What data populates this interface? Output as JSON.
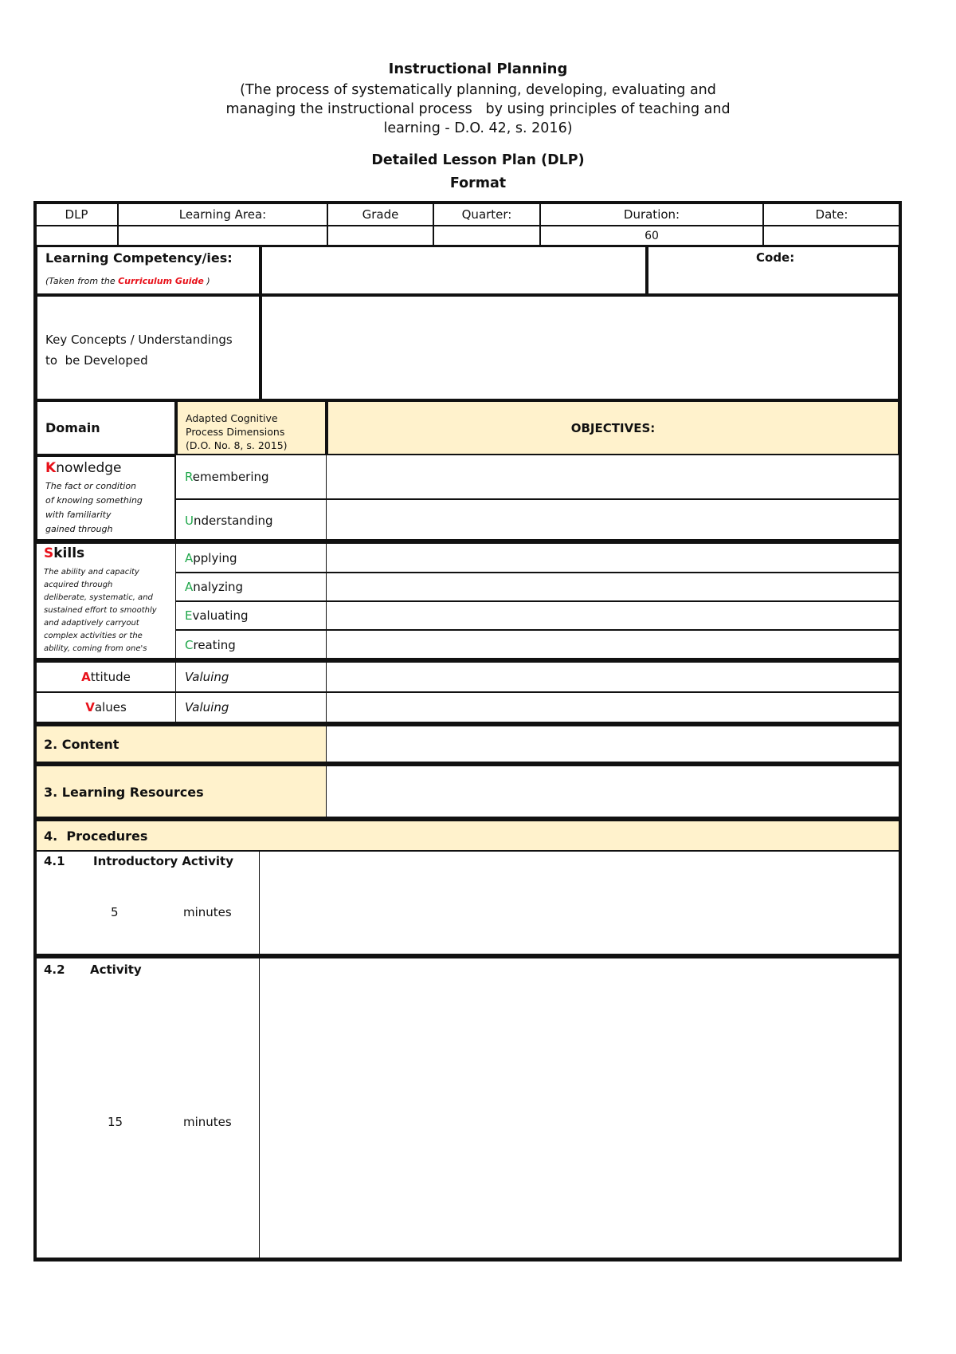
{
  "header": {
    "title": "Instructional Planning",
    "description_line1": "(The process of systematically planning, developing, evaluating and",
    "description_line2": "managing the instructional process   by using principles of teaching and",
    "description_line3": "learning - D.O. 42, s. 2016)",
    "doc_title": "Detailed Lesson Plan (DLP)",
    "doc_subtitle": "Format"
  },
  "info_row": {
    "labels": [
      "DLP",
      "Learning Area:",
      "Grade",
      "Quarter:",
      "Duration:",
      "Date:"
    ],
    "values": [
      "",
      "",
      "",
      "",
      "60",
      ""
    ]
  },
  "competency": {
    "label": "Learning Competency/ies:",
    "note_prefix": "(Taken from the ",
    "note_highlight": "Curriculum Guide",
    "note_suffix": " )",
    "value": "",
    "code_label": "Code:",
    "code_value": ""
  },
  "key_concepts": {
    "label_line1": "Key Concepts / Understandings",
    "label_line2": "to  be Developed",
    "value": ""
  },
  "objectives_header": {
    "domain_label": "Domain",
    "dimensions_line1": "Adapted Cognitive",
    "dimensions_line2": "Process Dimensions",
    "dimensions_line3": "(D.O. No. 8, s. 2015)",
    "objectives_label": "OBJECTIVES:"
  },
  "domains": {
    "knowledge": {
      "initial": "K",
      "rest": "nowledge",
      "desc": [
        "The fact or condition",
        "of knowing something",
        "with familiarity",
        "gained through"
      ],
      "processes": [
        {
          "initial": "R",
          "rest": "emembering",
          "objective": ""
        },
        {
          "initial": "U",
          "rest": "nderstanding",
          "objective": ""
        }
      ]
    },
    "skills": {
      "initial": "S",
      "rest": "kills",
      "desc": [
        "The ability and capacity",
        "acquired  through",
        "deliberate, systematic, and",
        "sustained effort to smoothly",
        "and adaptively carryout",
        "complex activities or the",
        "ability, coming from one's"
      ],
      "processes": [
        {
          "initial": "A",
          "rest": "pplying",
          "objective": ""
        },
        {
          "initial": "A",
          "rest": "nalyzing",
          "objective": ""
        },
        {
          "initial": "E",
          "rest": "valuating",
          "objective": ""
        },
        {
          "initial": "C",
          "rest": "reating",
          "objective": ""
        }
      ]
    },
    "attitude": {
      "initial": "A",
      "rest": "ttitude",
      "process": "Valuing",
      "objective": ""
    },
    "values": {
      "initial": "V",
      "rest": "alues",
      "process": "Valuing",
      "objective": ""
    }
  },
  "sections": {
    "content": {
      "label": "2. Content",
      "value": ""
    },
    "resources": {
      "label": "3. Learning Resources",
      "value": ""
    },
    "procedures": {
      "label": "4.  Procedures"
    }
  },
  "procedures": [
    {
      "number": "4.1",
      "title": "Introductory Activity",
      "minutes": "5",
      "unit": "minutes",
      "value": ""
    },
    {
      "number": "4.2",
      "title": "Activity",
      "minutes": "15",
      "unit": "minutes",
      "value": ""
    }
  ],
  "colors": {
    "section_fill": "#fff2cc",
    "domain_initial": "#e8111a",
    "process_initial": "#1fa64a"
  }
}
